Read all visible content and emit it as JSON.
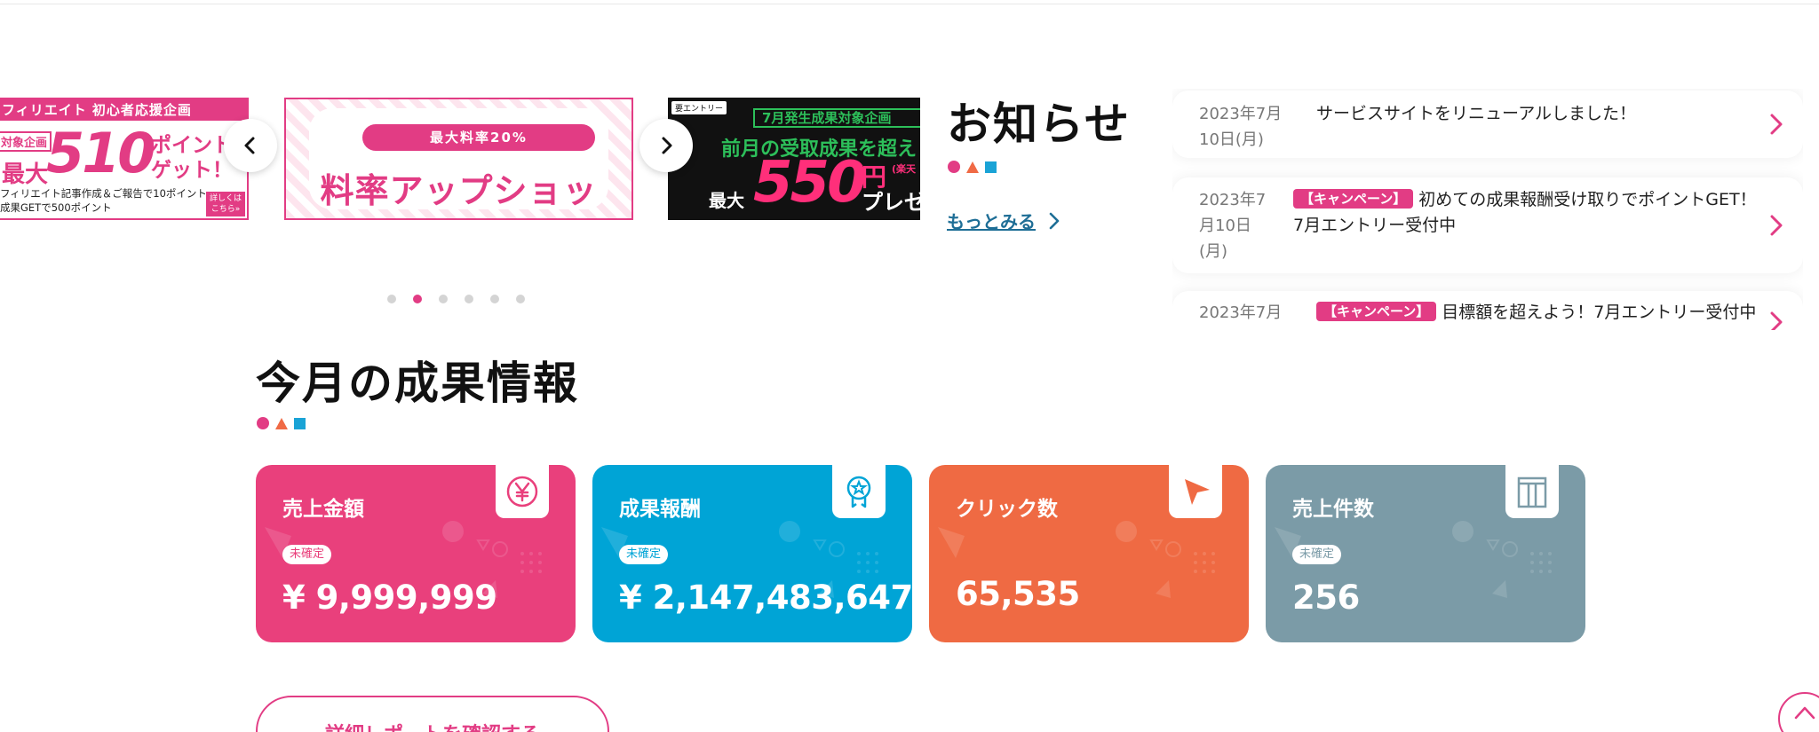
{
  "colors": {
    "accent": "#e23c84",
    "blue": "#00a4d6",
    "orange": "#ef6a43",
    "grey": "#7b9ba7",
    "link": "#1e6e96"
  },
  "carousel": {
    "prev_icon": "chevron-left-icon",
    "next_icon": "chevron-right-icon",
    "banner1": {
      "header": "フィリエイト 初心者応援企画",
      "tag": "対象企画",
      "max": "最大",
      "number": "510",
      "unit_line1": "ポイント",
      "unit_line2": "ゲット！",
      "foot_line1": "フィリエイト記事作成＆ご報告で10ポイント",
      "foot_line2": "成果GETで500ポイント",
      "detail": "詳しくはこちら»"
    },
    "banner2": {
      "pill": "最大料率20%",
      "title": "料率アップショップ"
    },
    "banner3": {
      "entry": "要エントリー",
      "box": "7月発生成果対象企画",
      "line": "前月の受取成果を超え",
      "max": "最大",
      "number": "550",
      "yen": "円",
      "rakuten": "(楽天",
      "present": "プレゼ"
    },
    "dots_count": 6,
    "active_dot": 1
  },
  "news": {
    "heading": "お知らせ",
    "more_label": "もっとみる",
    "items": [
      {
        "date_line1": "2023年7月",
        "date_line2": "10日(月)",
        "tag": "",
        "text": "サービスサイトをリニューアルしました！",
        "text2": ""
      },
      {
        "date_line1": "2023年7",
        "date_line2": "月10日",
        "date_line3": "(月)",
        "tag": "【キャンペーン】",
        "text": "初めての成果報酬受け取りでポイントGET！",
        "text2": "7月エントリー受付中"
      },
      {
        "date_line1": "2023年7月",
        "date_line2": "",
        "tag": "【キャンペーン】",
        "text": "目標額を超えよう！7月エントリー受付中",
        "text2": ""
      }
    ]
  },
  "results": {
    "heading": "今月の成果情報",
    "cards": [
      {
        "title": "売上金額",
        "badge": "未確定",
        "value": "¥ 9,999,999",
        "icon": "yen-icon"
      },
      {
        "title": "成果報酬",
        "badge": "未確定",
        "value": "¥ 2,147,483,647",
        "icon": "award-badge-icon"
      },
      {
        "title": "クリック数",
        "badge": "",
        "value": "65,535",
        "icon": "cursor-arrow-icon"
      },
      {
        "title": "売上件数",
        "badge": "未確定",
        "value": "256",
        "icon": "box-icon"
      }
    ],
    "report_button": "詳細レポートを確認する"
  },
  "page_top_icon": "chevron-up-icon"
}
